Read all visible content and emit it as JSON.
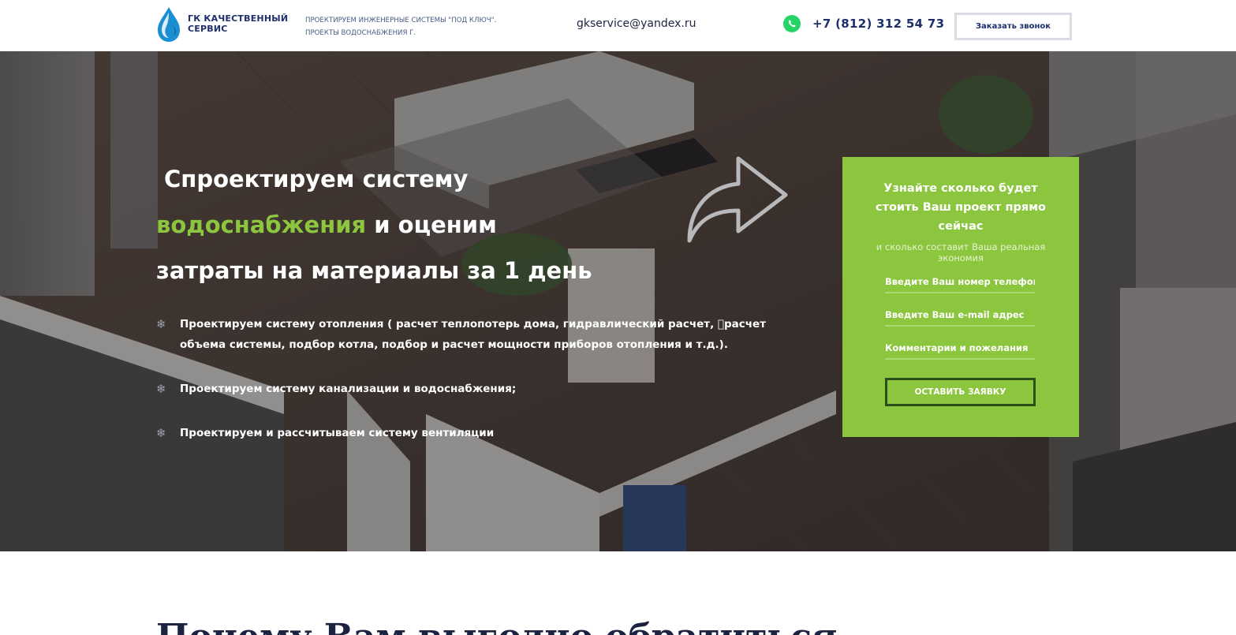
{
  "header": {
    "brand": "ГК КАЧЕСТВЕННЫЙ СЕРВИС",
    "tagline_line1": "ПРОЕКТИРУЕМ ИНЖЕНЕРНЫЕ СИСТЕМЫ \"ПОД КЛЮЧ\".",
    "tagline_line2": "ПРОЕКТЫ ВОДОСНАБЖЕНИЯ Г.",
    "email": "gkservice@yandex.ru",
    "phone": "+7 (812) 312 54 73",
    "callback_label": "Заказать звонок",
    "icons": {
      "logo": "water-drop-logo",
      "messenger": "whatsapp-icon"
    },
    "colors": {
      "brand": "#1e2f6b",
      "logo_blue": "#1b8fd2"
    }
  },
  "hero": {
    "headline_part1": "Спроектируем систему",
    "headline_accent": "водоснабжения",
    "headline_part2": " и оценим",
    "headline_part3": "затраты на материалы за 1 день",
    "accent_color": "#8cc63f",
    "features": [
      {
        "icon": "snowflake-bullet-icon",
        "text": "Проектируем систему отопления ( расчет теплопотерь дома, гидравлический расчет, \u0000расчет объема системы, подбор котла, подбор и расчет мощности приборов отопления и т.д.)."
      },
      {
        "icon": "snowflake-bullet-icon",
        "text": "Проектируем систему канализации и водоснабжения;"
      },
      {
        "icon": "snowflake-bullet-icon",
        "text": "Проектируем и рассчитываем систему вентиляции"
      }
    ],
    "bullet_glyph": "❄",
    "arrow_icon": "curved-arrow-right-icon"
  },
  "form": {
    "title": "Узнайте сколько будет стоить Ваш проект прямо сейчас",
    "subtitle": "и сколько составит Ваша реальная экономия",
    "phone_placeholder": "Введите Ваш номер телефона",
    "email_placeholder": "Введите Ваш e-mail адрес",
    "comment_placeholder": "Комментарии и пожелания",
    "submit_label": "ОСТАВИТЬ ЗАЯВКУ",
    "background_color": "#8cc63f"
  },
  "section": {
    "title": "Почему Вам выгодно обратиться к нам"
  }
}
